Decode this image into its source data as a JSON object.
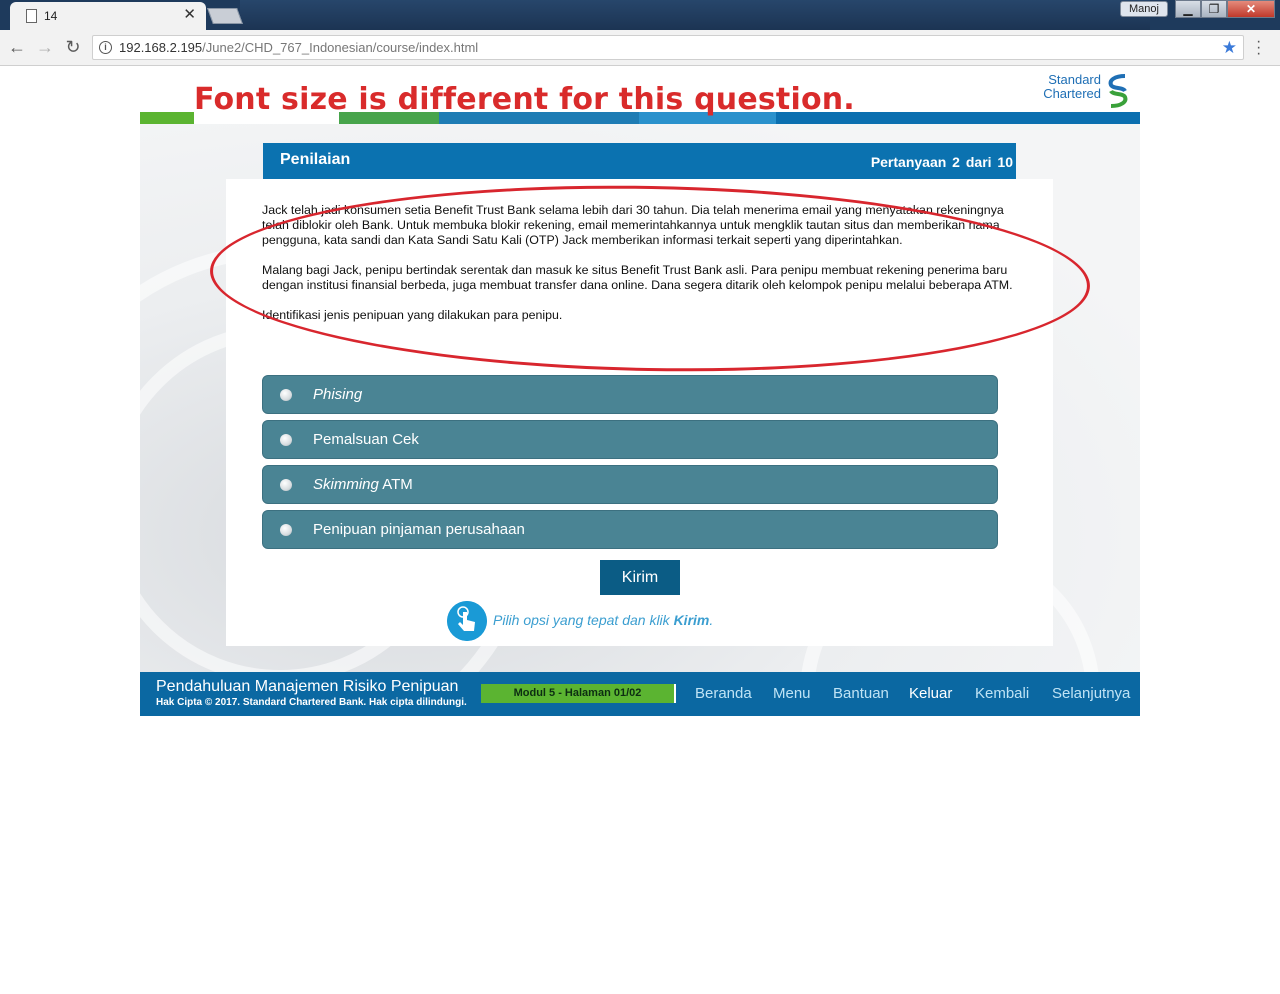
{
  "browser": {
    "tab_title": "14",
    "url_host": "192.168.2.195",
    "url_path": "/June2/CHD_767_Indonesian/course/index.html",
    "user_name": "Manoj"
  },
  "logo": {
    "line1": "Standard",
    "line2": "Chartered"
  },
  "annotation": {
    "title": "Font size is different for this question."
  },
  "panel": {
    "title": "Penilaian",
    "question_counter": "Pertanyaan  2  dari 10"
  },
  "question": {
    "paragraph1": "Jack telah jadi konsumen setia Benefit Trust Bank selama lebih dari 30 tahun.  Dia telah menerima email yang menyatakan rekeningnya telah diblokir oleh Bank. Untuk membuka blokir rekening, email memerintahkannya untuk mengklik tautan situs dan memberikan nama pengguna, kata sandi dan Kata Sandi Satu Kali (OTP) Jack memberikan informasi terkait seperti yang diperintahkan.",
    "paragraph2": "Malang bagi Jack, penipu bertindak serentak dan masuk ke situs Benefit Trust Bank asli. Para penipu membuat rekening penerima baru dengan institusi finansial berbeda, juga membuat transfer dana online. Dana segera ditarik oleh kelompok penipu melalui beberapa ATM.",
    "prompt": "Identifikasi jenis penipuan yang dilakukan para penipu."
  },
  "options": [
    {
      "italic": "Phising",
      "text": ""
    },
    {
      "italic": "",
      "text": "Pemalsuan Cek"
    },
    {
      "italic": "Skimming",
      "text": " ATM"
    },
    {
      "italic": "",
      "text": "Penipuan pinjaman perusahaan"
    }
  ],
  "submit_label": "Kirim",
  "hint": {
    "text": "Pilih opsi yang tepat dan klik ",
    "bold": "Kirim",
    "end": "."
  },
  "footer": {
    "course_title": "Pendahuluan Manajemen Risiko Penipuan",
    "copyright": "Hak Cipta © 2017. Standard Chartered Bank. Hak cipta dilindungi.",
    "module": "Modul 5 - Halaman 01/02",
    "nav": [
      "Beranda",
      "Menu",
      "Bantuan",
      "Keluar",
      "Kembali",
      "Selanjutnya"
    ],
    "active_nav": "Keluar"
  },
  "colors": {
    "brand_blue": "#0b72b0",
    "option_teal": "#4a8494",
    "annotation_red": "#d92b2b",
    "module_green": "#5bb431"
  }
}
